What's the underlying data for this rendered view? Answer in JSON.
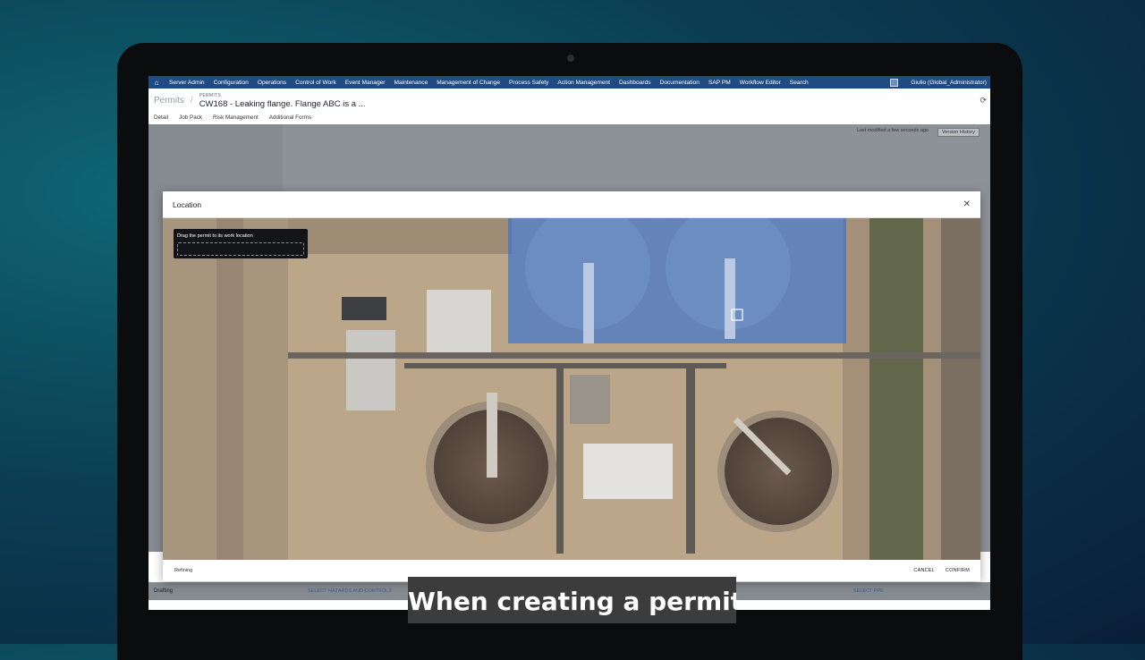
{
  "nav": {
    "home_icon": "home-icon",
    "items": [
      "Server Admin",
      "Configuration",
      "Operations",
      "Control of Work",
      "Event Manager",
      "Maintenance",
      "Management of Change",
      "Process Safety",
      "Action Management",
      "Dashboards",
      "Documentation",
      "SAP PM",
      "Workflow Editor",
      "Search"
    ],
    "user": "Giulio (Global_Administrator)"
  },
  "breadcrumb": {
    "root": "Permits",
    "section": "PERMITS",
    "title": "CW168 - Leaking flange. Flange ABC is a ..."
  },
  "tabs": [
    "Detail",
    "Job Pack",
    "Risk Management",
    "Additional Forms"
  ],
  "status": {
    "last_modified": "Last modified a few seconds ago",
    "version_history": "Version History"
  },
  "background": {
    "drafting": "Drafting",
    "select_hazards": "SELECT HAZARDS AND CONTROLS",
    "select_ppe": "SELECT PPE"
  },
  "modal": {
    "title": "Location",
    "close_icon": "close-icon",
    "tooltip": "Drag the permit to its work location",
    "refining": "Refining",
    "cancel": "CANCEL",
    "confirm": "CONFIRM"
  },
  "colors": {
    "nav": "#1f4a82",
    "selection": "#2f6fd6"
  },
  "caption": "When creating a permit,"
}
